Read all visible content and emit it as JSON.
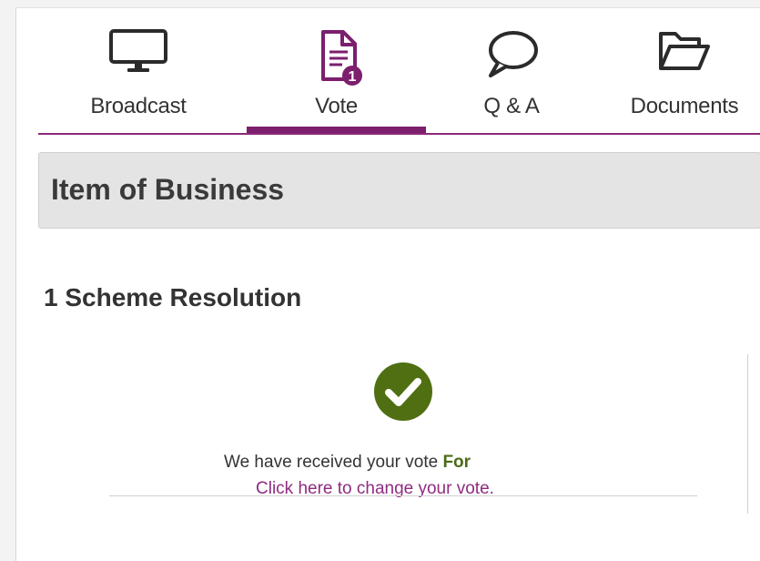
{
  "tabs": [
    {
      "label": "Broadcast",
      "icon": "monitor-icon"
    },
    {
      "label": "Vote",
      "icon": "document-icon",
      "badge": "1"
    },
    {
      "label": "Q & A",
      "icon": "speech-bubble-icon"
    },
    {
      "label": "Documents",
      "icon": "folder-icon"
    }
  ],
  "active_tab": "Vote",
  "section": {
    "title": "Item of Business"
  },
  "resolution": {
    "title": "1 Scheme Resolution",
    "received_text": "We have received your vote",
    "vote_choice": "For",
    "change_link": "Click here to change your vote."
  },
  "colors": {
    "accent": "#7c1f6d",
    "success": "#4a6b16",
    "link": "#8f2b82"
  }
}
